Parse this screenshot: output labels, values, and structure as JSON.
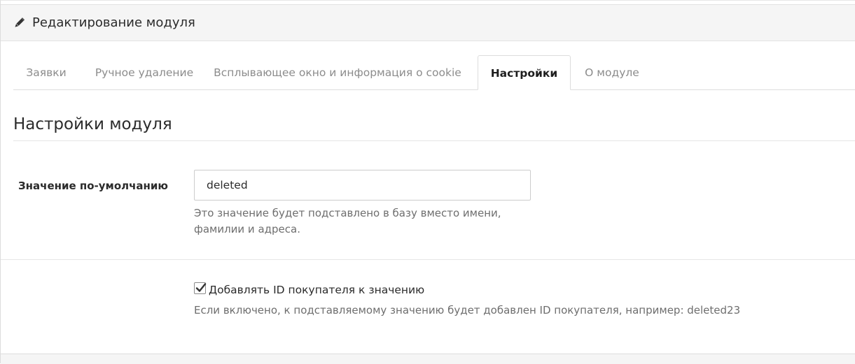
{
  "header": {
    "icon": "pencil-icon",
    "title": "Редактирование модуля"
  },
  "tabs": [
    {
      "label": "Заявки",
      "active": false
    },
    {
      "label": "Ручное удаление",
      "active": false
    },
    {
      "label": "Всплывающее окно и информация о cookie",
      "active": false
    },
    {
      "label": "Настройки",
      "active": true
    },
    {
      "label": "О модуле",
      "active": false
    }
  ],
  "section": {
    "title": "Настройки модуля"
  },
  "default_value": {
    "label": "Значение по-умолчанию",
    "value": "deleted",
    "help": "Это значение будет подставлено в базу вместо имени, фамилии и адреса."
  },
  "append_id": {
    "checked": true,
    "label": "Добавлять ID покупателя к значению",
    "help": "Если включено, к подставляемому значению будет добавлен ID покупателя, например: deleted23"
  },
  "colors": {
    "header_bg": "#f5f5f5",
    "text": "#2b2b2b",
    "muted": "#8c8c8c",
    "border": "#dddddd"
  }
}
